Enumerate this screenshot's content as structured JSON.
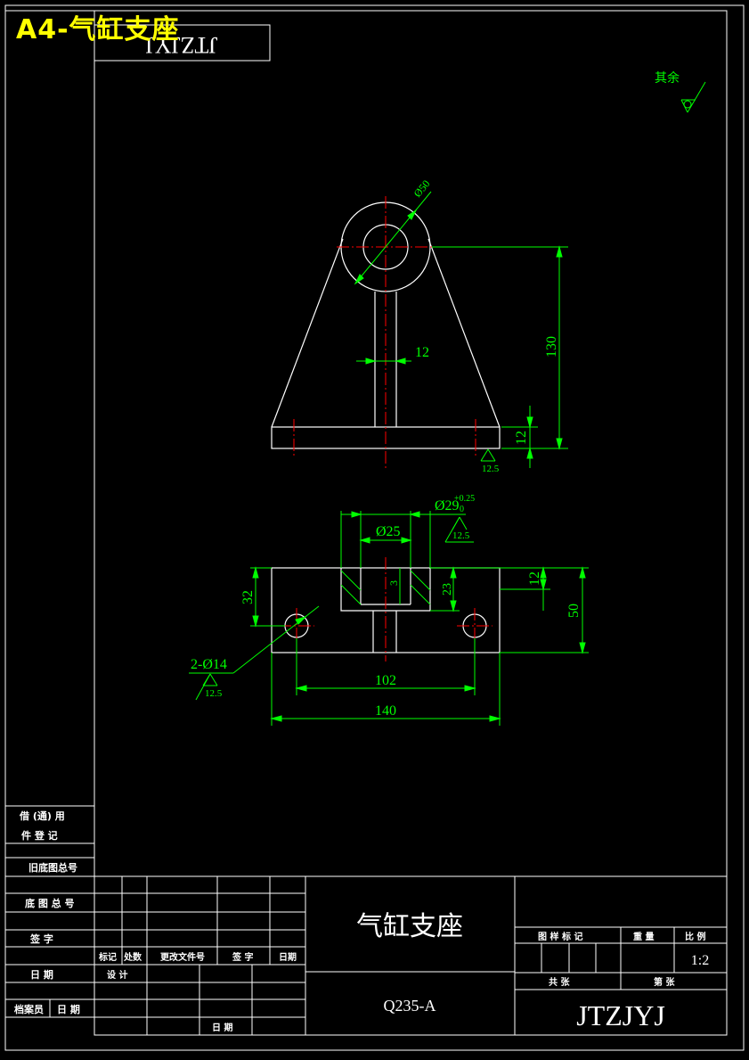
{
  "header": {
    "overlay_title": "A4-气缸支座",
    "drawing_code_box": "JTZJYJ"
  },
  "roughness_note": {
    "label": "其余"
  },
  "front_view": {
    "dims": {
      "hole_dia": "Ø50",
      "web_thickness": "12",
      "height": "130",
      "base_thickness": "12",
      "roughness": "12.5"
    }
  },
  "bottom_view": {
    "dims": {
      "bore_dia": "Ø29",
      "bore_tol_upper": "+0.25",
      "bore_tol_lower": "0",
      "bore_roughness": "12.5",
      "inner_dia": "Ø25",
      "chamfer": "3",
      "counterbore_depth": "23",
      "top_thickness": "12",
      "total_height": "50",
      "hole_height": "32",
      "holes": "2-Ø14",
      "holes_roughness": "12.5",
      "hole_spacing": "102",
      "overall_width": "140"
    }
  },
  "side_panel": {
    "usage_line1": "借 (通) 用",
    "usage_line2": "件 登 记",
    "old_drawing": "旧底图总号",
    "base_drawing": "底 图 总 号",
    "signature": "签    字",
    "date": "日    期",
    "archivist": "档案员",
    "archivist_date": "日 期"
  },
  "title_block": {
    "part_name": "气缸支座",
    "material": "Q235-A",
    "drawing_code": "JTZJYJ",
    "headers": {
      "mark": "标记",
      "count": "处数",
      "change_doc": "更改文件号",
      "sign": "签 字",
      "date": "日期",
      "design": "设 计",
      "date2": "日 期",
      "stage_mark": "图 样 标 记",
      "weight": "重 量",
      "scale": "比 例",
      "total_sheets": "共    张",
      "sheet_no": "第    张"
    },
    "scale_value": "1:2"
  },
  "colors": {
    "background": "#000000",
    "outline": "#ffffff",
    "dimension": "#00ff00",
    "centerline": "#ff0000",
    "title": "#ffff00"
  }
}
